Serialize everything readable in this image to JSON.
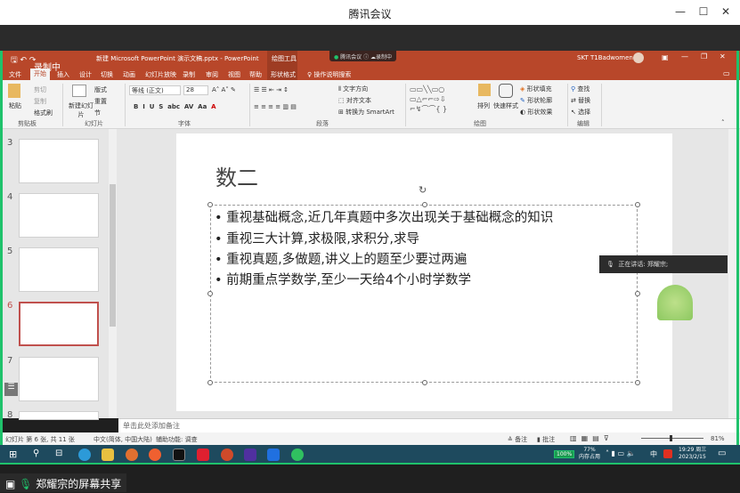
{
  "meeting": {
    "title": "腾讯会议",
    "min": "—",
    "max": "☐",
    "close": "✕",
    "share_label": "郑耀宗的屏幕共享",
    "recording": "录制中",
    "meeting_badge": "腾讯会议",
    "recording_badge": "录制中",
    "speaking": "正在讲话: 郑耀宗;"
  },
  "ppt": {
    "doc_title": "新建 Microsoft PowerPoint 演示文稿.pptx - PowerPoint",
    "drawing_tools": "绘图工具",
    "user": "SKT T1Badwomen",
    "tabs": [
      "文件",
      "开始",
      "插入",
      "设计",
      "切换",
      "动画",
      "幻灯片放映",
      "录制",
      "审阅",
      "视图",
      "帮助",
      "形状格式"
    ],
    "tell_me": "操作说明搜索",
    "ribbon": {
      "paste": "粘贴",
      "cut": "剪切",
      "copy": "复制",
      "format_painter": "格式刷",
      "clipboard": "剪贴板",
      "new_slide": "新建幻灯片",
      "layout": "版式",
      "reset": "重置",
      "section": "节",
      "slides": "幻灯片",
      "font_name": "等线 (正文)",
      "font_size": "28",
      "font": "字体",
      "text_direction": "文字方向",
      "align_text": "对齐文本",
      "smartart": "转换为 SmartArt",
      "paragraph": "段落",
      "arrange": "排列",
      "quick_styles": "快速样式",
      "shape_fill": "形状填充",
      "shape_outline": "形状轮廓",
      "shape_effects": "形状效果",
      "drawing": "绘图",
      "find": "查找",
      "replace": "替换",
      "select": "选择",
      "editing": "编辑"
    }
  },
  "thumbnails": [
    {
      "num": "3"
    },
    {
      "num": "4"
    },
    {
      "num": "5"
    },
    {
      "num": "6",
      "selected": true
    },
    {
      "num": "7"
    },
    {
      "num": "8"
    }
  ],
  "slide": {
    "title": "数二",
    "bullets": [
      "重视基础概念,近几年真题中多次出现关于基础概念的知识",
      "重视三大计算,求极限,求积分,求导",
      "重视真题,多做题,讲义上的题至少要过两遍",
      "前期重点学数学,至少一天给4个小时学数学"
    ]
  },
  "notes_placeholder": "单击此处添加备注",
  "status": {
    "slide_info": "幻灯片 第 6 张, 共 11 张",
    "language": "中文(简体, 中国大陆)",
    "accessibility": "辅助功能: 调查",
    "notes": "备注",
    "comments": "批注",
    "zoom": "81%"
  },
  "taskbar": {
    "battery": "100%",
    "memory": "77%",
    "memory_label": "内存占用",
    "ime": "中",
    "time": "19:29 周三",
    "date": "2023/2/15"
  },
  "colors": {
    "ppt_accent": "#b8472a",
    "share_border": "#1fc26b",
    "taskbar": "#1e4a5e"
  }
}
